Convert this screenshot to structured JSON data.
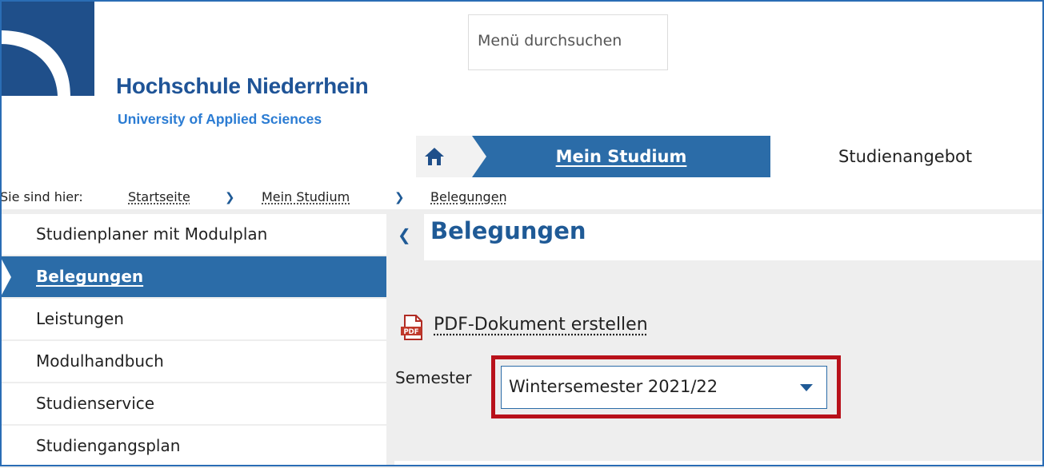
{
  "header": {
    "university_name": "Hochschule Niederrhein",
    "university_subtitle": "University of Applied Sciences",
    "search_placeholder": "Menü durchsuchen"
  },
  "nav": {
    "home_icon": "home-icon",
    "tabs": [
      {
        "label": "Mein Studium",
        "active": true
      },
      {
        "label": "Studienangebot",
        "active": false
      }
    ]
  },
  "breadcrumb": {
    "prefix": "Sie sind hier:",
    "items": [
      "Startseite",
      "Mein Studium",
      "Belegungen"
    ]
  },
  "sidebar": {
    "items": [
      {
        "label": "Studienplaner mit Modulplan",
        "active": false
      },
      {
        "label": "Belegungen",
        "active": true
      },
      {
        "label": "Leistungen",
        "active": false
      },
      {
        "label": "Modulhandbuch",
        "active": false
      },
      {
        "label": "Studienservice",
        "active": false
      },
      {
        "label": "Studiengangsplan",
        "active": false
      }
    ]
  },
  "main": {
    "title": "Belegungen",
    "pdf_link": "PDF-Dokument erstellen",
    "pdf_icon": "pdf-icon",
    "semester_label": "Semester",
    "semester_selected": "Wintersemester 2021/22"
  },
  "colors": {
    "brand_blue": "#2b6ca8",
    "title_blue": "#1f5a96",
    "highlight_red": "#b8111a"
  }
}
